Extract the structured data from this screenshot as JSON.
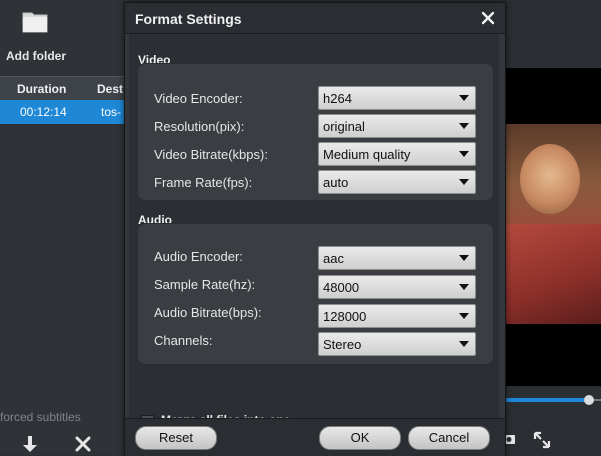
{
  "app": {
    "add_folder_label": "Add folder",
    "table": {
      "columns": [
        "Duration",
        "Dest"
      ],
      "rows": [
        {
          "duration": "00:12:14",
          "dest": "tos-"
        }
      ]
    },
    "forced_subtitles_label": "forced subtitles",
    "icons": [
      "folder-icon",
      "arrow-down-icon",
      "delete-icon",
      "snapshot-icon",
      "fullscreen-icon"
    ],
    "seek_progress": 0.88,
    "accent_color": "#1e88d6"
  },
  "dialog": {
    "title": "Format Settings",
    "close_icon": "close-icon",
    "video": {
      "group_label": "Video",
      "rows": [
        {
          "label": "Video Encoder:",
          "value": "h264"
        },
        {
          "label": "Resolution(pix):",
          "value": "original"
        },
        {
          "label": "Video Bitrate(kbps):",
          "value": "Medium quality"
        },
        {
          "label": "Frame Rate(fps):",
          "value": "auto"
        }
      ]
    },
    "audio": {
      "group_label": "Audio",
      "rows": [
        {
          "label": "Audio Encoder:",
          "value": "aac"
        },
        {
          "label": "Sample Rate(hz):",
          "value": "48000"
        },
        {
          "label": "Audio Bitrate(bps):",
          "value": "128000"
        },
        {
          "label": "Channels:",
          "value": "Stereo"
        }
      ]
    },
    "merge_label": "Merge all files into one",
    "merge_checked": false,
    "buttons": {
      "reset": "Reset",
      "ok": "OK",
      "cancel": "Cancel"
    }
  }
}
